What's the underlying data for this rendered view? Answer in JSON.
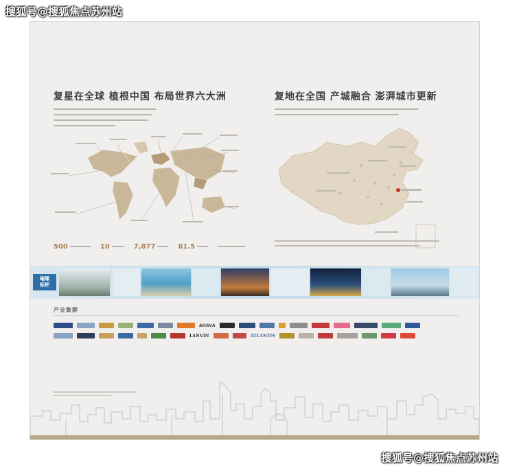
{
  "watermark": {
    "top": "搜狐号@搜狐焦点苏州站",
    "bottom": "搜狐号@搜狐焦点苏州站"
  },
  "left_panel": {
    "heading": "复星在全球  植根中国  布局世界六大洲"
  },
  "right_panel": {
    "heading": "复地在全国  产城融合  澎湃城市更新"
  },
  "stats": [
    "500",
    "10",
    "7,877",
    "81.5",
    ""
  ],
  "photo_strip": {
    "label": "璀璨\n标杆"
  },
  "industry": {
    "title": "产业集群",
    "logos_row1": [
      "",
      "",
      "",
      "",
      "",
      "",
      "",
      "AHAVA",
      "",
      "",
      "",
      "",
      "",
      "",
      "",
      "",
      "",
      ""
    ],
    "logos_row2": [
      "",
      "",
      "",
      "",
      "",
      "",
      "",
      "LANVIN",
      "",
      "",
      "ATLANTIS",
      "",
      "",
      "",
      "",
      "",
      "",
      "",
      ""
    ]
  },
  "colors": {
    "board": "#f0efed",
    "gold": "#a8875a",
    "map": "#c9b79a",
    "map_dark": "#b39c77",
    "strip_label": "#2d6fa6"
  }
}
